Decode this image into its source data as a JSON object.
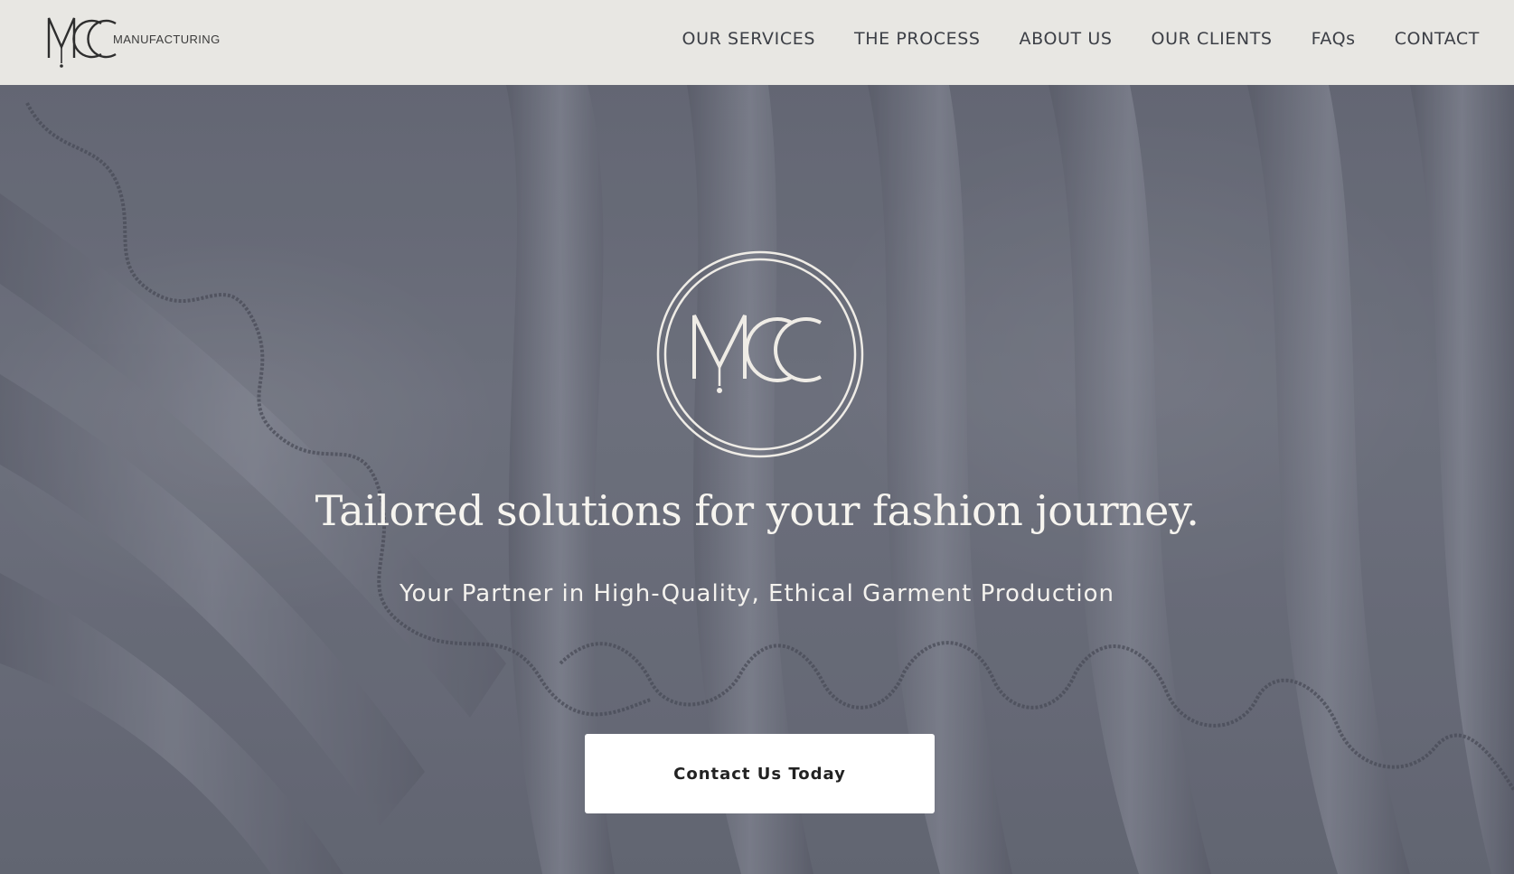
{
  "brand": {
    "monogram": "MCC",
    "wordmark": "MANUFACTURING"
  },
  "nav": {
    "items": [
      {
        "label": "OUR SERVICES"
      },
      {
        "label": "THE PROCESS"
      },
      {
        "label": "ABOUT US"
      },
      {
        "label": "OUR CLIENTS"
      },
      {
        "label": "FAQs"
      },
      {
        "label": "CONTACT"
      }
    ]
  },
  "hero": {
    "emblem_monogram": "MCC",
    "headline": "Tailored solutions for your fashion journey.",
    "subheadline": "Your Partner in High-Quality, Ethical Garment Production",
    "cta_label": "Contact Us Today",
    "background_description_icon": "ruffled-fabric-image"
  },
  "colors": {
    "header_bg": "#e8e7e3",
    "nav_text": "#3c3f46",
    "hero_text": "#f6f4ef",
    "cta_bg": "#ffffff",
    "cta_text": "#222222"
  }
}
